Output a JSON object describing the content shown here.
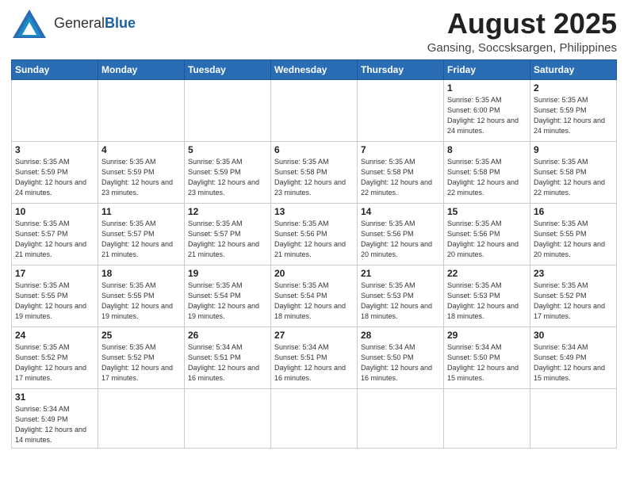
{
  "header": {
    "logo_general": "General",
    "logo_blue": "Blue",
    "month": "August 2025",
    "location": "Gansing, Soccsksargen, Philippines"
  },
  "weekdays": [
    "Sunday",
    "Monday",
    "Tuesday",
    "Wednesday",
    "Thursday",
    "Friday",
    "Saturday"
  ],
  "weeks": [
    [
      {
        "day": "",
        "info": ""
      },
      {
        "day": "",
        "info": ""
      },
      {
        "day": "",
        "info": ""
      },
      {
        "day": "",
        "info": ""
      },
      {
        "day": "",
        "info": ""
      },
      {
        "day": "1",
        "info": "Sunrise: 5:35 AM\nSunset: 6:00 PM\nDaylight: 12 hours\nand 24 minutes."
      },
      {
        "day": "2",
        "info": "Sunrise: 5:35 AM\nSunset: 5:59 PM\nDaylight: 12 hours\nand 24 minutes."
      }
    ],
    [
      {
        "day": "3",
        "info": "Sunrise: 5:35 AM\nSunset: 5:59 PM\nDaylight: 12 hours\nand 24 minutes."
      },
      {
        "day": "4",
        "info": "Sunrise: 5:35 AM\nSunset: 5:59 PM\nDaylight: 12 hours\nand 23 minutes."
      },
      {
        "day": "5",
        "info": "Sunrise: 5:35 AM\nSunset: 5:59 PM\nDaylight: 12 hours\nand 23 minutes."
      },
      {
        "day": "6",
        "info": "Sunrise: 5:35 AM\nSunset: 5:58 PM\nDaylight: 12 hours\nand 23 minutes."
      },
      {
        "day": "7",
        "info": "Sunrise: 5:35 AM\nSunset: 5:58 PM\nDaylight: 12 hours\nand 22 minutes."
      },
      {
        "day": "8",
        "info": "Sunrise: 5:35 AM\nSunset: 5:58 PM\nDaylight: 12 hours\nand 22 minutes."
      },
      {
        "day": "9",
        "info": "Sunrise: 5:35 AM\nSunset: 5:58 PM\nDaylight: 12 hours\nand 22 minutes."
      }
    ],
    [
      {
        "day": "10",
        "info": "Sunrise: 5:35 AM\nSunset: 5:57 PM\nDaylight: 12 hours\nand 21 minutes."
      },
      {
        "day": "11",
        "info": "Sunrise: 5:35 AM\nSunset: 5:57 PM\nDaylight: 12 hours\nand 21 minutes."
      },
      {
        "day": "12",
        "info": "Sunrise: 5:35 AM\nSunset: 5:57 PM\nDaylight: 12 hours\nand 21 minutes."
      },
      {
        "day": "13",
        "info": "Sunrise: 5:35 AM\nSunset: 5:56 PM\nDaylight: 12 hours\nand 21 minutes."
      },
      {
        "day": "14",
        "info": "Sunrise: 5:35 AM\nSunset: 5:56 PM\nDaylight: 12 hours\nand 20 minutes."
      },
      {
        "day": "15",
        "info": "Sunrise: 5:35 AM\nSunset: 5:56 PM\nDaylight: 12 hours\nand 20 minutes."
      },
      {
        "day": "16",
        "info": "Sunrise: 5:35 AM\nSunset: 5:55 PM\nDaylight: 12 hours\nand 20 minutes."
      }
    ],
    [
      {
        "day": "17",
        "info": "Sunrise: 5:35 AM\nSunset: 5:55 PM\nDaylight: 12 hours\nand 19 minutes."
      },
      {
        "day": "18",
        "info": "Sunrise: 5:35 AM\nSunset: 5:55 PM\nDaylight: 12 hours\nand 19 minutes."
      },
      {
        "day": "19",
        "info": "Sunrise: 5:35 AM\nSunset: 5:54 PM\nDaylight: 12 hours\nand 19 minutes."
      },
      {
        "day": "20",
        "info": "Sunrise: 5:35 AM\nSunset: 5:54 PM\nDaylight: 12 hours\nand 18 minutes."
      },
      {
        "day": "21",
        "info": "Sunrise: 5:35 AM\nSunset: 5:53 PM\nDaylight: 12 hours\nand 18 minutes."
      },
      {
        "day": "22",
        "info": "Sunrise: 5:35 AM\nSunset: 5:53 PM\nDaylight: 12 hours\nand 18 minutes."
      },
      {
        "day": "23",
        "info": "Sunrise: 5:35 AM\nSunset: 5:52 PM\nDaylight: 12 hours\nand 17 minutes."
      }
    ],
    [
      {
        "day": "24",
        "info": "Sunrise: 5:35 AM\nSunset: 5:52 PM\nDaylight: 12 hours\nand 17 minutes."
      },
      {
        "day": "25",
        "info": "Sunrise: 5:35 AM\nSunset: 5:52 PM\nDaylight: 12 hours\nand 17 minutes."
      },
      {
        "day": "26",
        "info": "Sunrise: 5:34 AM\nSunset: 5:51 PM\nDaylight: 12 hours\nand 16 minutes."
      },
      {
        "day": "27",
        "info": "Sunrise: 5:34 AM\nSunset: 5:51 PM\nDaylight: 12 hours\nand 16 minutes."
      },
      {
        "day": "28",
        "info": "Sunrise: 5:34 AM\nSunset: 5:50 PM\nDaylight: 12 hours\nand 16 minutes."
      },
      {
        "day": "29",
        "info": "Sunrise: 5:34 AM\nSunset: 5:50 PM\nDaylight: 12 hours\nand 15 minutes."
      },
      {
        "day": "30",
        "info": "Sunrise: 5:34 AM\nSunset: 5:49 PM\nDaylight: 12 hours\nand 15 minutes."
      }
    ],
    [
      {
        "day": "31",
        "info": "Sunrise: 5:34 AM\nSunset: 5:49 PM\nDaylight: 12 hours\nand 14 minutes."
      },
      {
        "day": "",
        "info": ""
      },
      {
        "day": "",
        "info": ""
      },
      {
        "day": "",
        "info": ""
      },
      {
        "day": "",
        "info": ""
      },
      {
        "day": "",
        "info": ""
      },
      {
        "day": "",
        "info": ""
      }
    ]
  ]
}
